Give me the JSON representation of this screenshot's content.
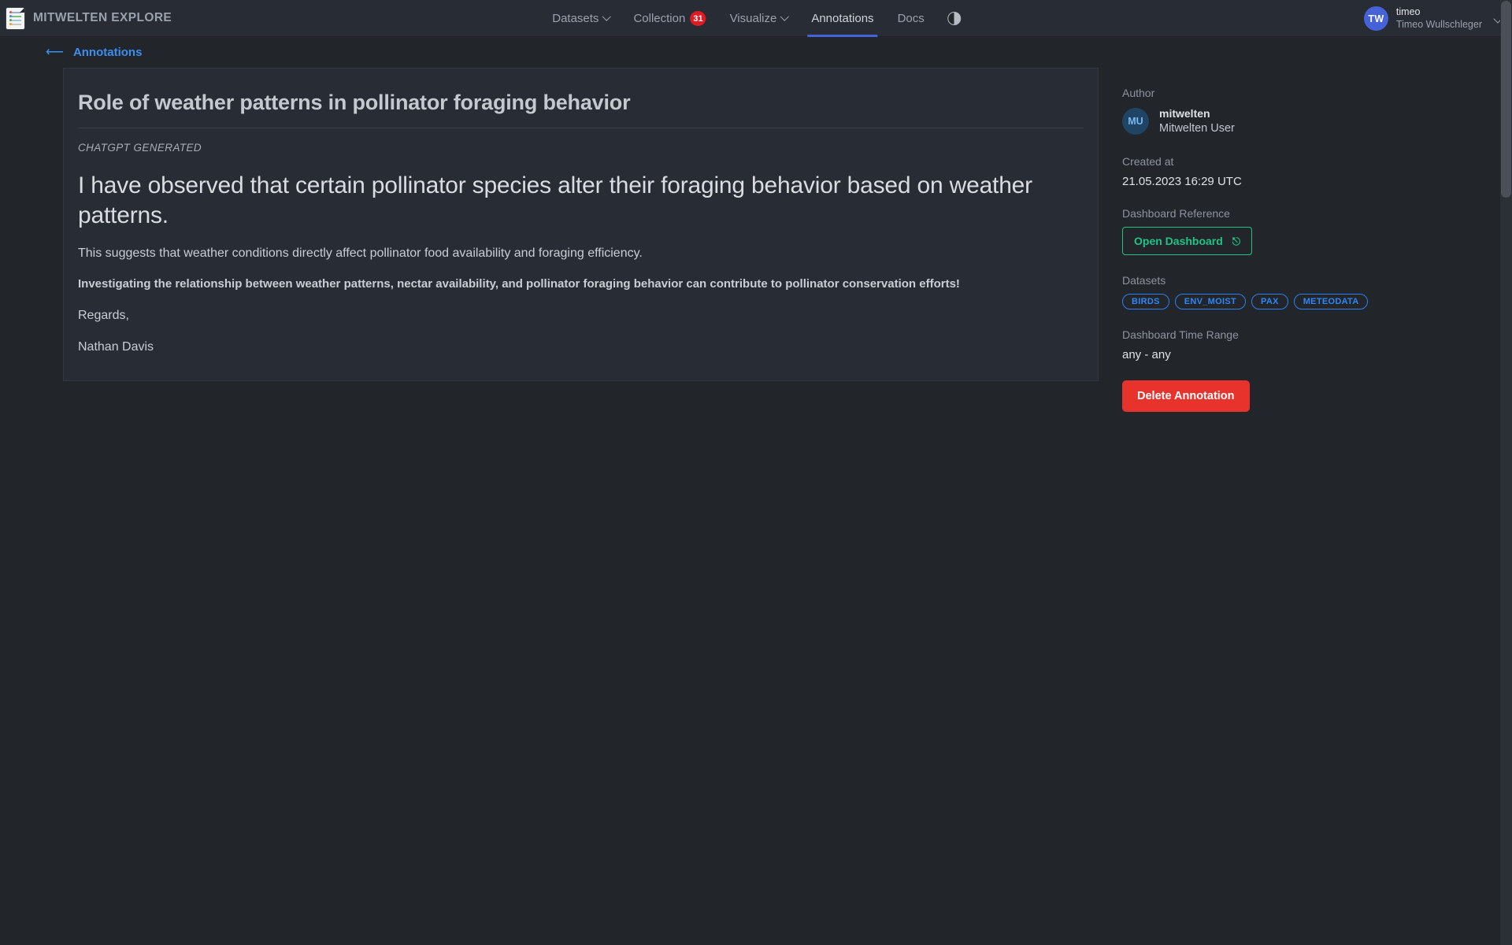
{
  "app": {
    "brand_title": "MITWELTEN EXPLORE",
    "logo_icon": "document-lines-icon"
  },
  "nav": {
    "items": [
      {
        "label": "Datasets",
        "has_chevron": true,
        "active": false
      },
      {
        "label": "Collection",
        "badge": "31",
        "has_chevron": false,
        "active": false
      },
      {
        "label": "Visualize",
        "has_chevron": true,
        "active": false
      },
      {
        "label": "Annotations",
        "has_chevron": false,
        "active": true
      },
      {
        "label": "Docs",
        "has_chevron": false,
        "active": false
      }
    ],
    "theme_toggle_icon": "contrast-half-circle-icon"
  },
  "user": {
    "initials": "TW",
    "username": "timeo",
    "fullname": "Timeo Wullschleger",
    "chevron_icon": "chevron-down-icon"
  },
  "breadcrumb": {
    "back_icon": "back-arrow-icon",
    "label": "Annotations"
  },
  "annotation": {
    "title": "Role of weather patterns in pollinator foraging behavior",
    "tagline": "CHATGPT GENERATED",
    "lead": "I have observed that certain pollinator species alter their foraging behavior based on weather patterns.",
    "paragraph": "This suggests that weather conditions directly affect pollinator food availability and foraging efficiency.",
    "paragraph_bold": "Investigating the relationship between weather patterns, nectar availability, and pollinator foraging behavior can contribute to pollinator conservation efforts!",
    "signoff": "Regards,",
    "signature": "Nathan Davis"
  },
  "sidebar": {
    "author_label": "Author",
    "author": {
      "initials": "MU",
      "handle": "mitwelten",
      "fullname": "Mitwelten User"
    },
    "created_label": "Created at",
    "created_value": "21.05.2023 16:29 UTC",
    "dashboard_label": "Dashboard Reference",
    "dashboard_button": "Open Dashboard",
    "dashboard_button_icon": "external-link-icon",
    "datasets_label": "Datasets",
    "datasets": [
      "BIRDS",
      "ENV_MOIST",
      "PAX",
      "METEODATA"
    ],
    "time_range_label": "Dashboard Time Range",
    "time_range_value": "any - any",
    "delete_button": "Delete Annotation"
  },
  "colors": {
    "accent_blue": "#4562d8",
    "link_blue": "#3c8ef0",
    "tag_blue": "#2f87f5",
    "green": "#1ec486",
    "danger_red": "#e8322c",
    "badge_red": "#e01b24",
    "background": "#22252a",
    "surface": "#282c34"
  }
}
